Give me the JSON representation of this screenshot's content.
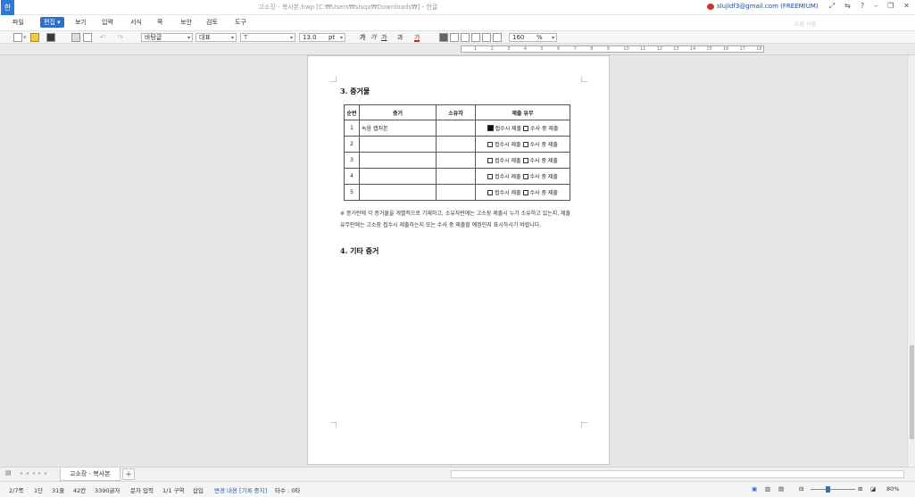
{
  "window": {
    "title": "고소장 - 복사본.hwp [C:₩Users₩sisqx₩Downloads₩] - 한글",
    "account": "slujldf3@gmail.com (FREEMIUM)"
  },
  "menu": {
    "items": [
      "파일",
      "편집",
      "보기",
      "입력",
      "서식",
      "쪽",
      "보안",
      "검토",
      "도구"
    ],
    "active": "편집",
    "faded_text": "도움 시험"
  },
  "toolbar": {
    "style_font": "바탕글",
    "style_name": "대표",
    "font_size": "13.0",
    "size_unit": "pt",
    "text_styles": [
      "가",
      "가",
      "가",
      "과",
      "가"
    ],
    "zoom": "160",
    "zoom_unit": "%"
  },
  "ruler": {
    "ticks": [
      "1",
      "2",
      "3",
      "4",
      "5",
      "6",
      "7",
      "8",
      "9",
      "10",
      "11",
      "12",
      "13",
      "14",
      "15",
      "16",
      "17",
      "18"
    ]
  },
  "document": {
    "section3_title": "3. 증거물",
    "table": {
      "headers": [
        "순번",
        "증거",
        "소유자",
        "제출 유무"
      ],
      "rows": [
        {
          "no": "1",
          "evidence": "녹음 캡처본",
          "owner": "",
          "checked": true
        },
        {
          "no": "2",
          "evidence": "",
          "owner": "",
          "checked": false
        },
        {
          "no": "3",
          "evidence": "",
          "owner": "",
          "checked": false
        },
        {
          "no": "4",
          "evidence": "",
          "owner": "",
          "checked": false
        },
        {
          "no": "5",
          "evidence": "",
          "owner": "",
          "checked": false
        }
      ],
      "option_1": "접수시 제출",
      "option_2": "수사 중 제출"
    },
    "note": "※ 증거란에 각 증거물을 개별적으로 기재하고, 소유자란에는 고소장 제출시 누가 소유하고 있는지, 제출 유무란에는 고소장 접수시 제출하는지 또는 수사 중 제출할 예정인지 표시하시기 바랍니다.",
    "section4_title": "4. 기타 증거"
  },
  "tabs": {
    "sheet_name": "고소장 - 복사본",
    "add": "+"
  },
  "status": {
    "page": "2/7쪽",
    "column": "1단",
    "line": "31줄",
    "col": "42칸",
    "chars": "3390글자",
    "mode": "문자 입력",
    "section": "1/1 구역",
    "insert": "삽입",
    "track": "변경 내용 [기록 중지]",
    "typo": "타수 : 0타",
    "zoom": "80%"
  }
}
